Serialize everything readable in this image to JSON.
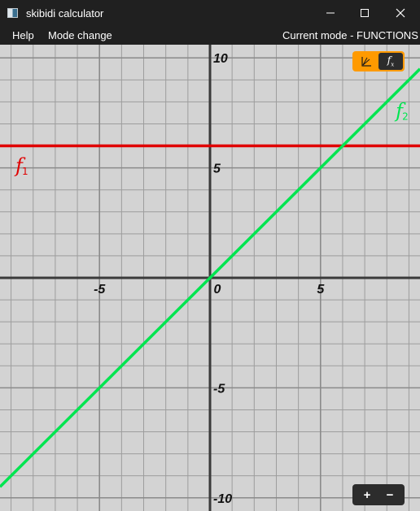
{
  "window": {
    "title": "skibidi calculator",
    "icons": {
      "app": "app-icon",
      "minimize": "minimize-icon",
      "maximize": "maximize-icon",
      "close": "close-icon"
    }
  },
  "menu": {
    "items": [
      "Help",
      "Mode change"
    ],
    "status": "Current mode - FUNCTIONS"
  },
  "toolbar": {
    "mode_toggle": [
      {
        "icon": "graph-icon",
        "active": true
      },
      {
        "icon": "function-icon",
        "label": "f",
        "sub": "x",
        "active": false
      }
    ],
    "accent": "#ff9a00",
    "zoom": {
      "plus": "+",
      "minus": "−"
    }
  },
  "chart_data": {
    "type": "line",
    "xlim": [
      -9.5,
      9.5
    ],
    "ylim": [
      -10.6,
      10.6
    ],
    "grid": true,
    "grid_step": 1,
    "major_grid_step": 5,
    "x_ticks": [
      -5,
      0,
      5
    ],
    "x_tick_labels": [
      "-5",
      "0",
      "5"
    ],
    "y_ticks": [
      10,
      5,
      -5,
      -10
    ],
    "y_tick_labels": [
      "10",
      "5",
      "-5",
      "-10"
    ],
    "series": [
      {
        "label": "f",
        "sub": "1",
        "color": "#e00000",
        "expr": "y = 6",
        "x": [
          -9.5,
          9.5
        ],
        "y": [
          6,
          6
        ],
        "label_pos": [
          -8.8,
          4.8
        ]
      },
      {
        "label": "f",
        "sub": "2",
        "color": "#00e550",
        "expr": "y = x",
        "x": [
          -9.5,
          9.5
        ],
        "y": [
          -9.5,
          9.5
        ],
        "label_pos": [
          8.4,
          7.3
        ]
      }
    ]
  }
}
